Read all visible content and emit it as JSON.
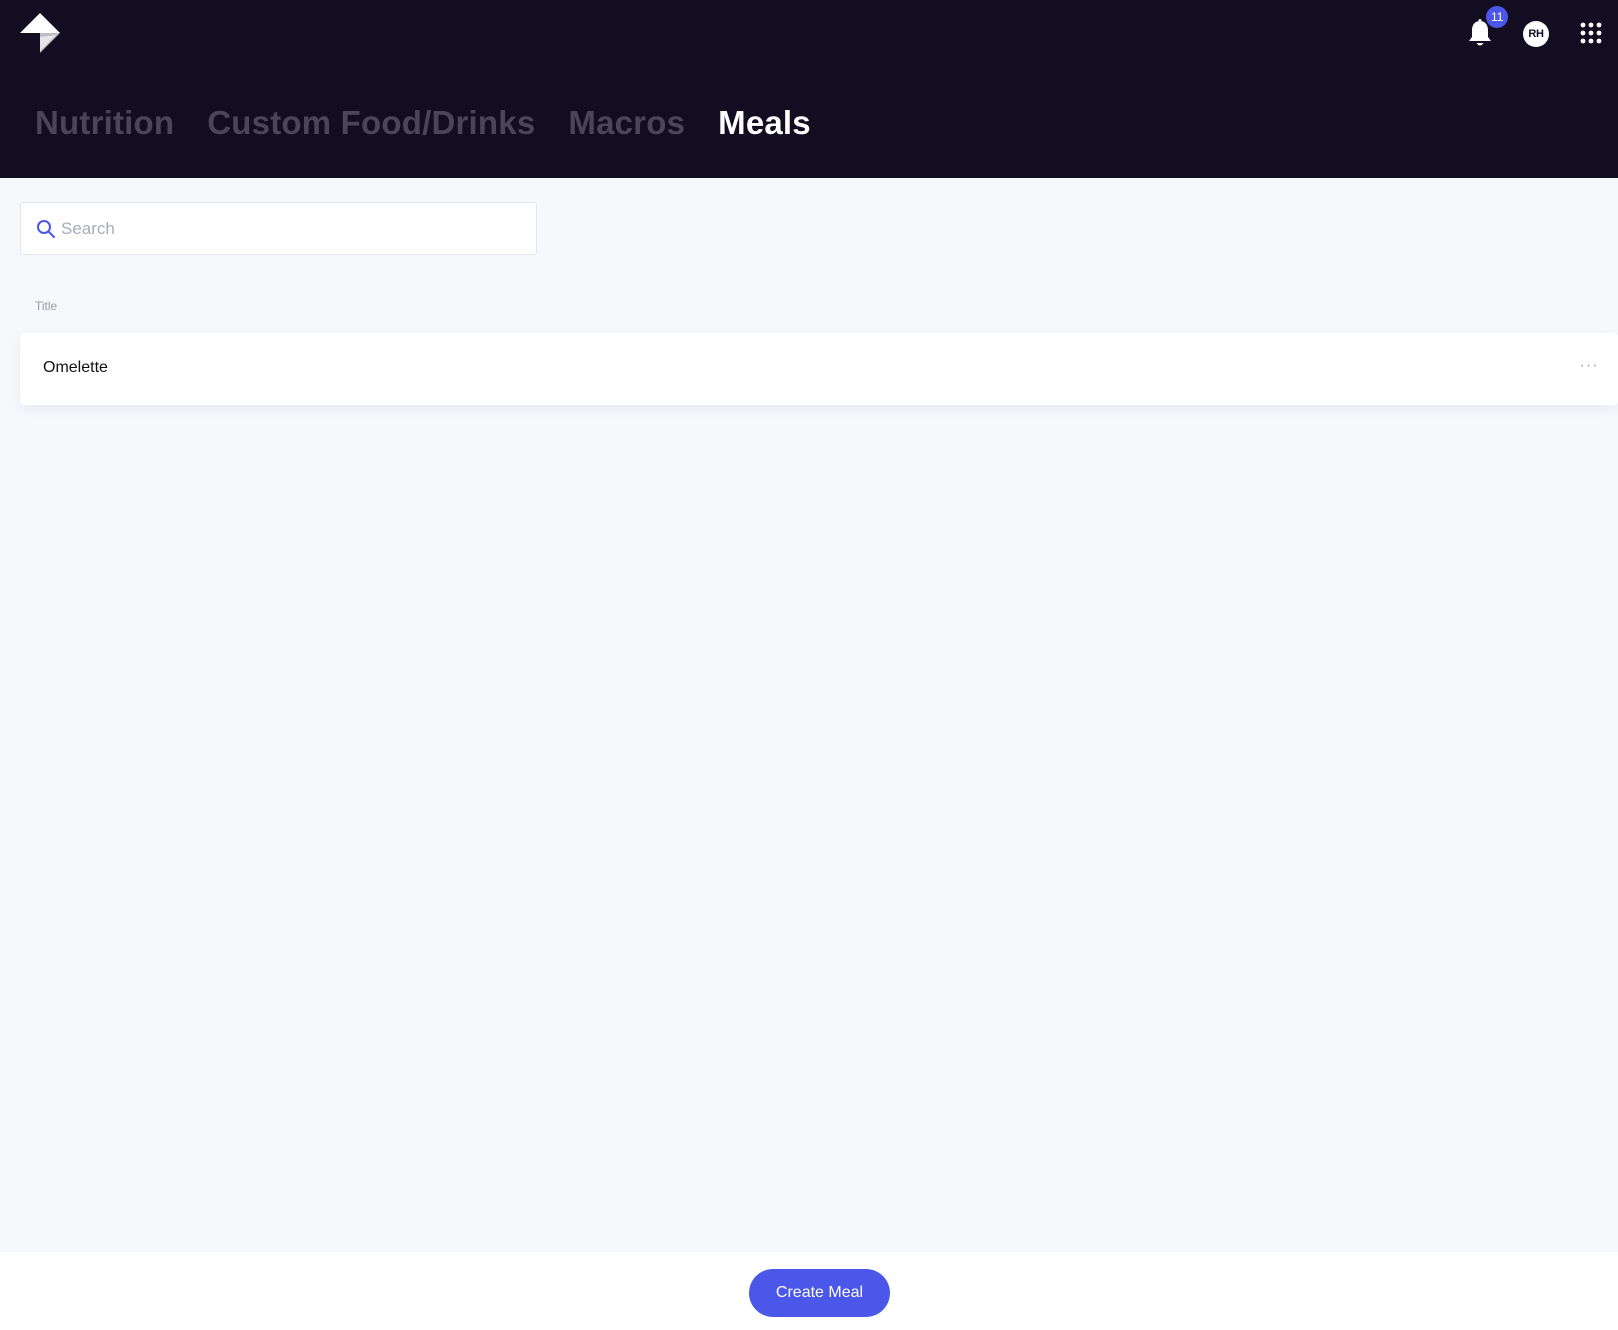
{
  "header": {
    "logo_icon": "app-logo-icon",
    "notifications": {
      "icon": "bell-icon",
      "count": "11"
    },
    "user_avatar": "RH",
    "apps_icon": "apps-grid-icon"
  },
  "tabs": [
    {
      "label": "Nutrition",
      "active": false
    },
    {
      "label": "Custom Food/Drinks",
      "active": false
    },
    {
      "label": "Macros",
      "active": false
    },
    {
      "label": "Meals",
      "active": true
    }
  ],
  "search": {
    "icon": "search-icon",
    "placeholder": "Search",
    "value": ""
  },
  "table": {
    "column_title": "Title",
    "rows": [
      {
        "title": "Omelette",
        "menu": "···"
      }
    ]
  },
  "footer": {
    "create_button": "Create Meal"
  },
  "colors": {
    "header_bg": "#130d22",
    "accent": "#4b57e8",
    "page_bg": "#f6f8fc",
    "inactive_tab": "#4a4558"
  }
}
